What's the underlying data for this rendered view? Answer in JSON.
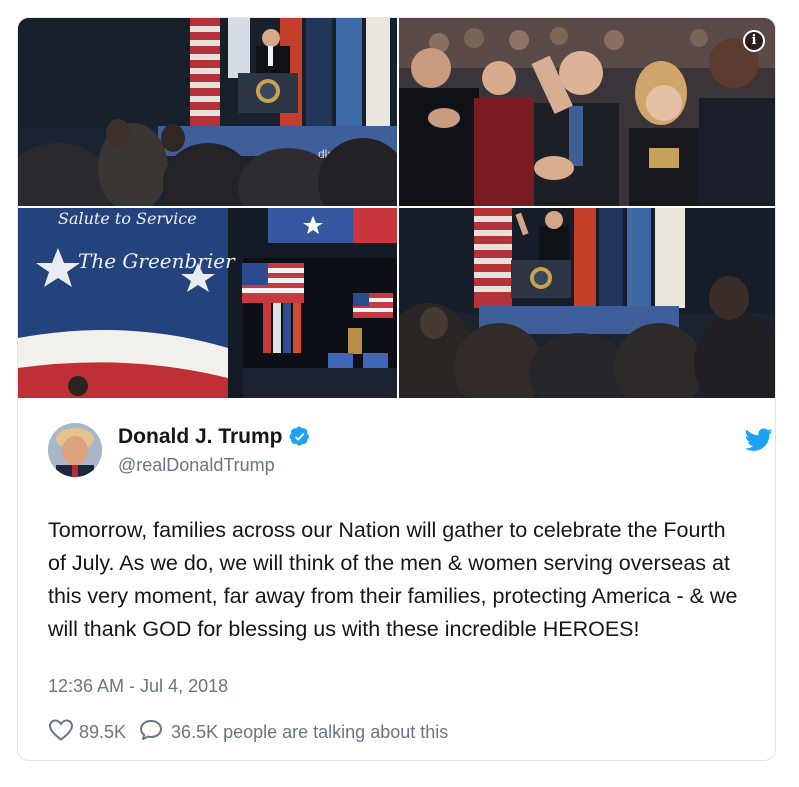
{
  "tweet": {
    "author": {
      "name": "Donald J. Trump",
      "handle": "@realDonaldTrump",
      "verified": true
    },
    "text": "Tomorrow, families across our Nation will gather to celebrate the Fourth of July. As we do, we will think of the men & women serving overseas at this very moment, far away from their families, protecting America - & we will thank GOD for blessing us with these incredible HEROES!",
    "timestamp": "12:36 AM - Jul 4, 2018",
    "likes": "89.5K",
    "talking": "36.5K people are talking about this"
  },
  "media": {
    "info_icon": "i",
    "banner_text": "Salute to Service",
    "banner_script": "The Greenbrier"
  },
  "colors": {
    "twitter_blue": "#1da1f2",
    "text_primary": "#14171a",
    "text_secondary": "#657786",
    "border": "#e1e8ed"
  },
  "icons": [
    "info-icon",
    "verified-badge-icon",
    "twitter-bird-icon",
    "heart-icon",
    "comment-bubble-icon"
  ]
}
